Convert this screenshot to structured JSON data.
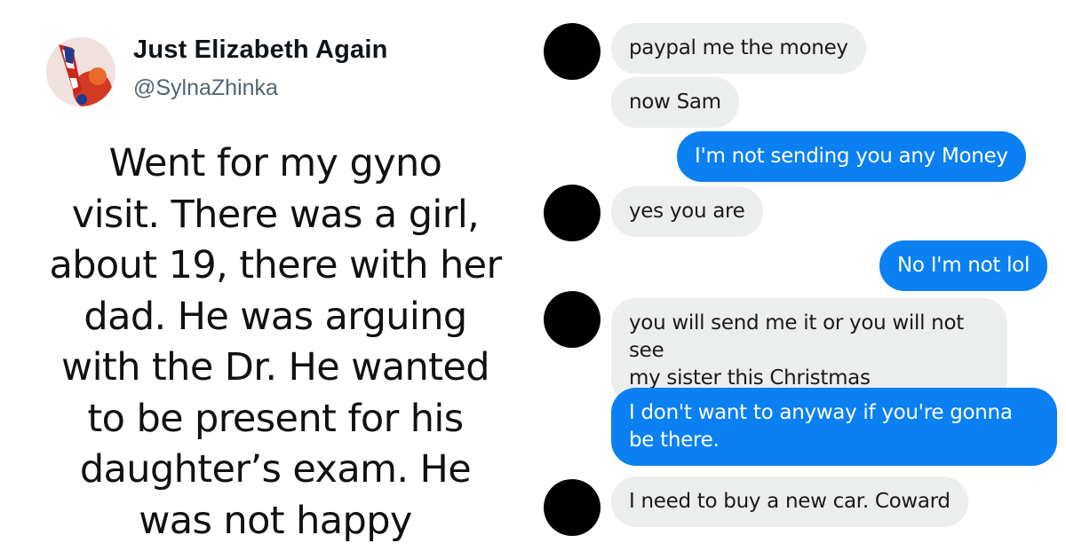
{
  "tweet": {
    "author_name": "Just Elizabeth Again",
    "author_handle": "@SylnaZhinka",
    "avatar_icon": "profile-avatar-flag-heel",
    "body_lines": [
      "Went for my gyno",
      "visit. There was a girl,",
      "about 19, there with her",
      "dad. He was arguing",
      "with the Dr. He wanted",
      "to be present for his",
      "daughter’s exam. He",
      "was not happy"
    ]
  },
  "chat": {
    "incoming_color": "#eceded",
    "outgoing_color": "#0a80f2",
    "messages": [
      {
        "sender": "them",
        "text": "paypal me the money"
      },
      {
        "sender": "them",
        "text": "now Sam"
      },
      {
        "sender": "me",
        "text": "I'm not sending you any  Money"
      },
      {
        "sender": "them",
        "text": "yes you are"
      },
      {
        "sender": "me",
        "text": "No I'm not lol"
      },
      {
        "sender": "them",
        "lines": [
          "you will send me it or you will not see",
          "my sister this Christmas"
        ]
      },
      {
        "sender": "me",
        "lines": [
          "I don't want to anyway if you're gonna",
          "be there."
        ]
      },
      {
        "sender": "them",
        "text": "I need to buy a new car. Coward"
      }
    ]
  }
}
